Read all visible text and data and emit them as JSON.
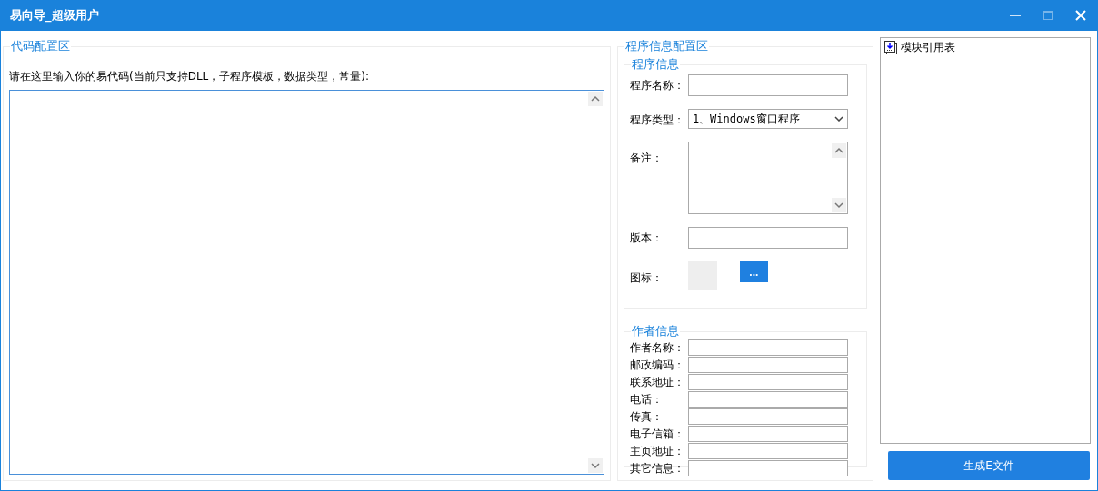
{
  "window": {
    "title": "易向导_超级用户",
    "maximize_disabled": true
  },
  "code_panel": {
    "title": "代码配置区",
    "prompt": "请在这里输入你的易代码(当前只支持DLL，子程序模板，数据类型，常量):"
  },
  "program_panel": {
    "title": "程序信息配置区",
    "program_group": {
      "title": "程序信息",
      "fields": [
        {
          "kind": "text",
          "label": "程序名称："
        },
        {
          "kind": "select",
          "label": "程序类型：",
          "value": "1、Windows窗口程序"
        },
        {
          "kind": "memo",
          "label": "备注："
        },
        {
          "kind": "text",
          "label": "版本："
        },
        {
          "kind": "icon",
          "label": "图标：",
          "button": "..."
        }
      ]
    },
    "author_group": {
      "title": "作者信息",
      "fields": [
        "作者名称：",
        "邮政编码：",
        "联系地址：",
        "电话：",
        "传真：",
        "电子信箱：",
        "主页地址：",
        "其它信息："
      ]
    }
  },
  "module_tree": {
    "items": [
      {
        "label": "模块引用表"
      }
    ]
  },
  "generate_button": "生成E文件"
}
